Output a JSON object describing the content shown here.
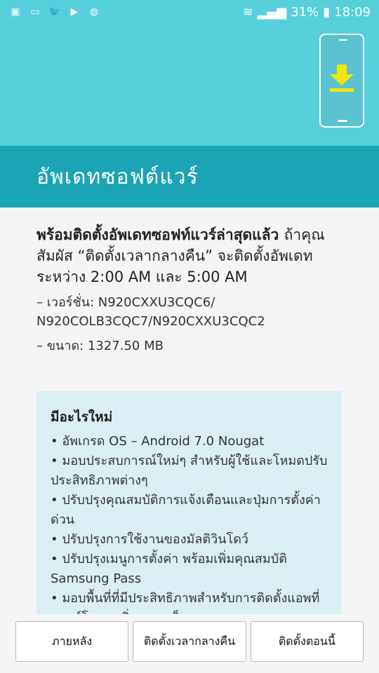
{
  "status": {
    "battery": "31%",
    "time": "18:09"
  },
  "title": "อัพเดทซอฟต์แวร์",
  "main": {
    "headline": "พร้อมติดตั้งอัพเดทซอฟท์แวร์ล่าสุดแล้ว",
    "description": "ถ้าคุณสัมผัส “ติดตั้งเวลากลางคืน” จะติดตั้งอัพเดทระหว่าง 2:00 AM และ 5:00 AM",
    "version_line1": "– เวอร์ชั่น: N920CXXU3CQC6/",
    "version_line2": "N920COLB3CQC7/N920CXXU3CQC2",
    "size": "– ขนาด: 1327.50 MB"
  },
  "whats_new": {
    "heading": "มีอะไรใหม่",
    "items": [
      "อัพเกรด OS – Android 7.0 Nougat",
      "มอบประสบการณ์ใหม่ๆ สำหรับผู้ใช้และโหมดปรับประสิทธิภาพต่างๆ",
      "ปรับปรุงคุณสมบัติการแจ้งเตือนและปุ่มการตั้งค่าด่วน",
      "ปรับปรุงการใช้งานของมัลติวินโดว์",
      "ปรับปรุงเมนูการตั้งค่า พร้อมเพิ่มคุณสมบัติ Samsung Pass",
      "มอบพื้นที่ที่มีประสิทธิภาพสำหรับการติดตั้งแอพที่ดาวน์โหลด เพิ่มความเร็วของการ"
    ]
  },
  "buttons": {
    "later": "ภายหลัง",
    "install_night": "ติดตั้งเวลากลางคืน",
    "install_now": "ติดตั้งตอนนี้"
  },
  "colors": {
    "header": "#55cfdc",
    "title_bar": "#1aa4b5",
    "whats_new_bg": "#dbeef4",
    "download_arrow": "#f2e60a"
  }
}
